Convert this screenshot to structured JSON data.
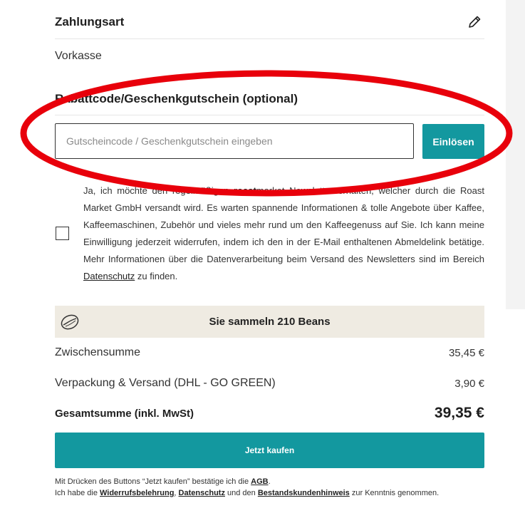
{
  "payment": {
    "title": "Zahlungsart",
    "value": "Vorkasse"
  },
  "coupon": {
    "title": "Rabattcode/Geschenkgutschein (optional)",
    "placeholder": "Gutscheincode / Geschenkgutschein eingeben",
    "button_label": "Einlösen"
  },
  "newsletter": {
    "text_1": "Ja, ich möchte den regelmäßigen ",
    "brand_bold": "roast",
    "text_2": "market Newsletter erhalten, welcher durch die Roast Market GmbH versandt wird. Es warten spannende Informationen & tolle Angebote über Kaffee, Kaffeemaschinen, Zubehör und vieles mehr rund um den Kaffeegenuss auf Sie. Ich kann meine Einwilligung jederzeit widerrufen, indem ich den in der E-Mail enthaltenen Abmeldelink betätige. Mehr Informationen über die Datenverarbeitung beim Versand des Newsletters sind im Bereich ",
    "link": "Datenschutz",
    "text_3": " zu finden."
  },
  "beans": {
    "text": "Sie sammeln 210 Beans",
    "icon": "coffee-bean-icon"
  },
  "summary": {
    "subtotal_label": "Zwischensumme",
    "subtotal_value": "35,45 €",
    "shipping_label": "Verpackung & Versand (DHL - GO GREEN)",
    "shipping_value": "3,90 €",
    "total_label": "Gesamtsumme (inkl. MwSt)",
    "total_value": "39,35 €"
  },
  "buy_button": "Jetzt kaufen",
  "legal": {
    "line1_a": "Mit Drücken des Buttons “Jetzt kaufen” bestätige ich die ",
    "agb": "AGB",
    "line1_b": ".",
    "line2_a": "Ich habe die ",
    "widerruf": "Widerrufsbelehrung",
    "sep1": ", ",
    "datenschutz": "Datenschutz",
    "sep2": " und den ",
    "bestandskunden": "Bestandskundenhinweis",
    "line2_b": " zur Kenntnis genommen."
  },
  "colors": {
    "accent": "#13989f",
    "beans_bg": "#efebe2",
    "annotation": "#e8000b"
  }
}
